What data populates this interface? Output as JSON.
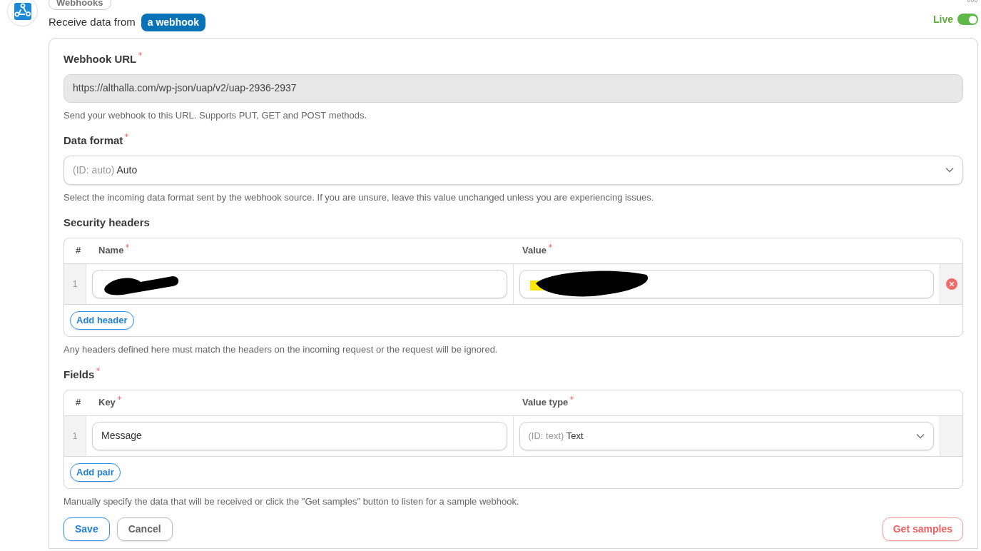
{
  "breadcrumb": "Webhooks",
  "trigger": {
    "prefix": "Receive data from",
    "source": "a webhook"
  },
  "live": {
    "label": "Live",
    "on": true
  },
  "webhook_url": {
    "label": "Webhook URL",
    "required": true,
    "value": "https://althalla.com/wp-json/uap/v2/uap-2936-2937",
    "help": "Send your webhook to this URL. Supports PUT, GET and POST methods."
  },
  "data_format": {
    "label": "Data format",
    "required": true,
    "id_prefix": "(ID: auto)",
    "value": "Auto",
    "help": "Select the incoming data format sent by the webhook source. If you are unsure, leave this value unchanged unless you are experiencing issues."
  },
  "security_headers": {
    "label": "Security headers",
    "columns": [
      {
        "label": "#",
        "required": false
      },
      {
        "label": "Name",
        "required": true
      },
      {
        "label": "Value",
        "required": true
      }
    ],
    "rows": [
      {
        "index": "1",
        "name_redacted": true,
        "value_redacted": true
      }
    ],
    "add_button": "Add header",
    "help": "Any headers defined here must match the headers on the incoming request or the request will be ignored."
  },
  "fields": {
    "label": "Fields",
    "required": true,
    "columns": [
      {
        "label": "#",
        "required": false
      },
      {
        "label": "Key",
        "required": true
      },
      {
        "label": "Value type",
        "required": true
      }
    ],
    "rows": [
      {
        "index": "1",
        "key": "Message",
        "type_id": "(ID: text)",
        "type": "Text"
      }
    ],
    "add_button": "Add pair",
    "help": "Manually specify the data that will be received or click the \"Get samples\" button to listen for a sample webhook."
  },
  "buttons": {
    "save": "Save",
    "cancel": "Cancel",
    "get_samples": "Get samples"
  }
}
